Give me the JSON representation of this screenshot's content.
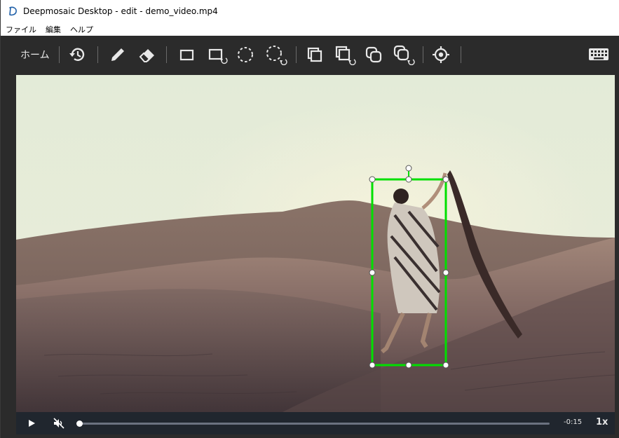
{
  "window": {
    "title": "Deepmosaic Desktop - edit - demo_video.mp4",
    "app_icon": "deepmosaic-logo-icon"
  },
  "menubar": {
    "items": [
      {
        "label": "ファイル"
      },
      {
        "label": "編集"
      },
      {
        "label": "ヘルプ"
      }
    ]
  },
  "toolbar": {
    "home_label": "ホーム",
    "tools": [
      {
        "name": "history-icon"
      },
      {
        "name": "pencil-icon"
      },
      {
        "name": "eraser-icon"
      },
      {
        "name": "rectangle-icon"
      },
      {
        "name": "rectangle-rotate-icon"
      },
      {
        "name": "ellipse-icon"
      },
      {
        "name": "ellipse-rotate-icon"
      },
      {
        "name": "copy-rectangle-icon"
      },
      {
        "name": "copy-rectangle-rotate-icon"
      },
      {
        "name": "copy-rounded-icon"
      },
      {
        "name": "copy-rounded-rotate-icon"
      },
      {
        "name": "target-icon"
      },
      {
        "name": "keyboard-icon"
      }
    ]
  },
  "canvas": {
    "selection_color": "#00e000",
    "handle_color": "#ffffff"
  },
  "player": {
    "time_remaining": "-0:15",
    "speed": "1x",
    "progress": 0.0,
    "muted": true
  },
  "colors": {
    "toolbar_bg": "#2b2b2b",
    "controls_bg": "#20262e",
    "accent": "#00e000"
  }
}
